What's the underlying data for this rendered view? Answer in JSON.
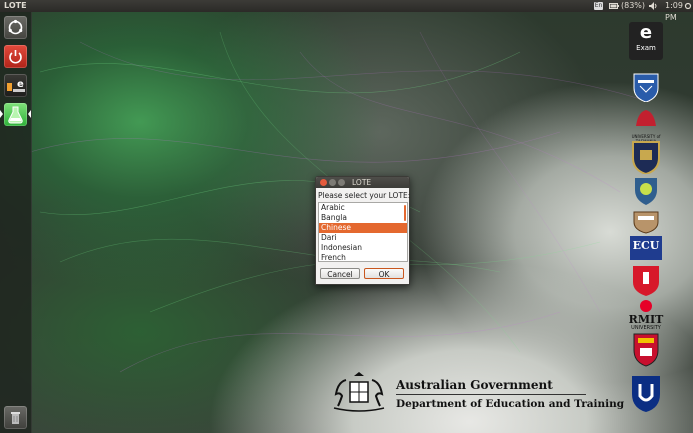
{
  "top_panel": {
    "window_title": "LOTE",
    "keyboard_indicator": "En",
    "battery_text": "(83%)",
    "clock": "1:09 PM",
    "icons": [
      "keyboard-icon",
      "battery-icon",
      "volume-icon",
      "settings-icon"
    ]
  },
  "launcher": {
    "items": [
      {
        "name": "dash-home-icon"
      },
      {
        "name": "power-icon"
      },
      {
        "name": "exam-app-icon",
        "label": "e"
      },
      {
        "name": "lab-flask-icon"
      },
      {
        "name": "trash-icon"
      }
    ]
  },
  "dialog": {
    "title": "LOTE",
    "prompt": "Please select your LOTE:",
    "options": [
      "Arabic",
      "Bangla",
      "Chinese",
      "Dari",
      "Indonesian",
      "French"
    ],
    "selected": "Chinese",
    "cancel_label": "Cancel",
    "ok_label": "OK",
    "accent": "#e4682f"
  },
  "branding": {
    "exam_logo_letter": "e",
    "exam_logo_word": "Exam",
    "university_label": "UNIVERSITY of TASMANIA",
    "ecu_label": "ECU",
    "rmit_label": "RMIT",
    "rmit_sub": "UNIVERSITY",
    "gov_line1": "Australian Government",
    "gov_line2": "Department of Education and Training"
  }
}
